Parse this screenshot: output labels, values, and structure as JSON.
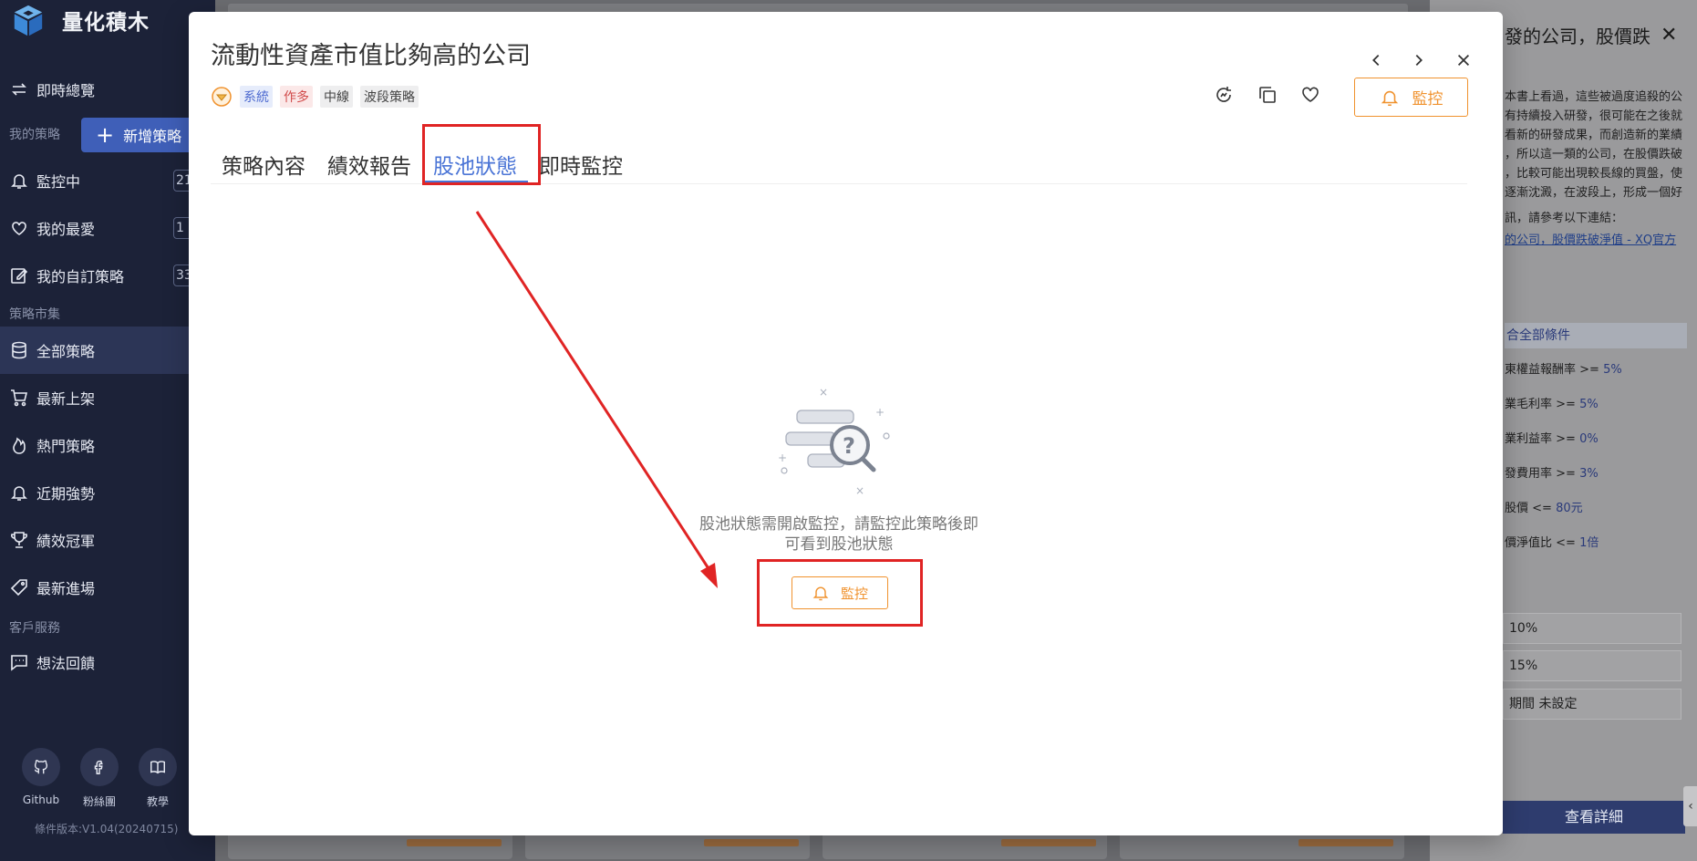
{
  "sidebar": {
    "brand": "量化積木",
    "overview": "即時總覽",
    "my_strategies_section": "我的策略",
    "add_strategy": "新增策略",
    "items_mine": [
      {
        "label": "監控中",
        "badge": "21"
      },
      {
        "label": "我的最愛",
        "badge": "1"
      },
      {
        "label": "我的自訂策略",
        "badge": "33"
      }
    ],
    "market_section": "策略市集",
    "items_market": [
      {
        "label": "全部策略"
      },
      {
        "label": "最新上架"
      },
      {
        "label": "熱門策略"
      },
      {
        "label": "近期強勢"
      },
      {
        "label": "績效冠軍"
      },
      {
        "label": "最新進場"
      }
    ],
    "service_section": "客戶服務",
    "feedback": "想法回饋",
    "footer_links": [
      {
        "label": "Github",
        "icon": "github-icon"
      },
      {
        "label": "粉絲團",
        "icon": "facebook-icon"
      },
      {
        "label": "教學",
        "icon": "book-icon"
      }
    ],
    "version": "條件版本:V1.04(20240715)"
  },
  "right_panel": {
    "title": "發的公司，股價跌",
    "desc_lines": [
      "本書上看過，這些被過度追殺的公",
      "有持續投入研發，很可能在之後就",
      "看新的研發成果，而創造新的業績",
      "，所以這一類的公司，在股價跌破",
      "，比較可能出現較長線的買盤，使",
      "逐漸沈澱，在波段上，形成一個好"
    ],
    "link_intro": "訊，請參考以下連結：",
    "link_text": "的公司，股價跌破淨值 - XQ官方",
    "cond_head": "合全部條件",
    "conditions": [
      {
        "label": "東權益報酬率 >= ",
        "value": "5%"
      },
      {
        "label": "業毛利率 >= ",
        "value": "5%"
      },
      {
        "label": "業利益率 >= ",
        "value": "0%"
      },
      {
        "label": "發費用率 >= ",
        "value": "3%"
      },
      {
        "label": "股價 <= ",
        "value": "80元"
      },
      {
        "label": "價淨值比 <= ",
        "value": "1倍"
      }
    ],
    "boxes": [
      "10%",
      "15%",
      "期間 未設定"
    ],
    "detail_button": "查看詳細"
  },
  "modal": {
    "title": "流動性資產市值比夠高的公司",
    "tags": [
      "系統",
      "作多",
      "中線",
      "波段策略"
    ],
    "watch_label": "監控",
    "tabs": [
      {
        "label": "策略內容",
        "active": false
      },
      {
        "label": "績效報告",
        "active": false
      },
      {
        "label": "股池狀態",
        "active": true
      },
      {
        "label": "即時監控",
        "active": false
      }
    ],
    "empty_line1": "股池狀態需開啟監控，請監控此策略後即",
    "empty_line2": "可看到股池狀態",
    "watch_center_label": "監控"
  },
  "colors": {
    "accent_orange": "#f0922e",
    "tab_active": "#4a74d6",
    "highlight_red": "#e02424",
    "sidebar_bg": "#1c2238"
  }
}
